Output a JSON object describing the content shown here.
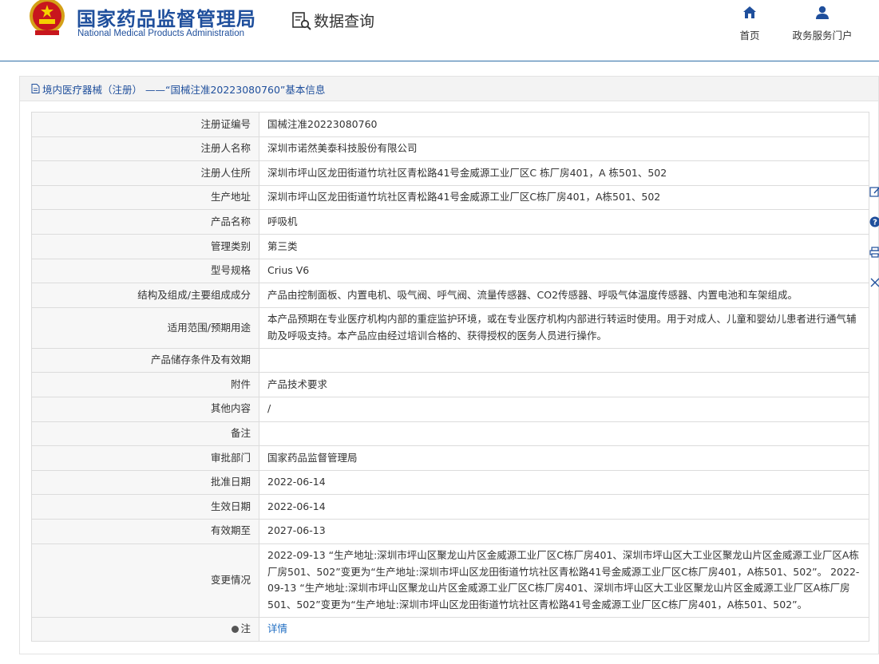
{
  "header": {
    "agency_name_cn": "国家药品监督管理局",
    "agency_name_en": "National Medical Products Administration",
    "data_query_label": "数据查询",
    "nav": {
      "home_label": "首页",
      "portal_label": "政务服务门户"
    },
    "brand_color": "#1f4f9c"
  },
  "panel": {
    "title": "境内医疗器械（注册） ——“国械注准20223080760”基本信息"
  },
  "fields": [
    {
      "label": "注册证编号",
      "value": "国械注准20223080760"
    },
    {
      "label": "注册人名称",
      "value": "深圳市诺然美泰科技股份有限公司"
    },
    {
      "label": "注册人住所",
      "value": "深圳市坪山区龙田街道竹坑社区青松路41号金威源工业厂区C 栋厂房401，A 栋501、502"
    },
    {
      "label": "生产地址",
      "value": "深圳市坪山区龙田街道竹坑社区青松路41号金威源工业厂区C栋厂房401，A栋501、502"
    },
    {
      "label": "产品名称",
      "value": "呼吸机"
    },
    {
      "label": "管理类别",
      "value": "第三类"
    },
    {
      "label": "型号规格",
      "value": "Crius V6"
    },
    {
      "label": "结构及组成/主要组成成分",
      "value": "产品由控制面板、内置电机、吸气阀、呼气阀、流量传感器、CO2传感器、呼吸气体温度传感器、内置电池和车架组成。"
    },
    {
      "label": "适用范围/预期用途",
      "value": "本产品预期在专业医疗机构内部的重症监护环境，或在专业医疗机构内部进行转运时使用。用于对成人、儿童和婴幼儿患者进行通气辅助及呼吸支持。本产品应由经过培训合格的、获得授权的医务人员进行操作。"
    },
    {
      "label": "产品储存条件及有效期",
      "value": ""
    },
    {
      "label": "附件",
      "value": "产品技术要求"
    },
    {
      "label": "其他内容",
      "value": "/"
    },
    {
      "label": "备注",
      "value": ""
    },
    {
      "label": "审批部门",
      "value": "国家药品监督管理局"
    },
    {
      "label": "批准日期",
      "value": "2022-06-14"
    },
    {
      "label": "生效日期",
      "value": "2022-06-14"
    },
    {
      "label": "有效期至",
      "value": "2027-06-13"
    },
    {
      "label": "变更情况",
      "value": "2022-09-13 “生产地址:深圳市坪山区聚龙山片区金威源工业厂区C栋厂房401、深圳市坪山区大工业区聚龙山片区金威源工业厂区A栋厂房501、502”变更为“生产地址:深圳市坪山区龙田街道竹坑社区青松路41号金威源工业厂区C栋厂房401，A栋501、502”。 2022-09-13 “生产地址:深圳市坪山区聚龙山片区金威源工业厂区C栋厂房401、深圳市坪山区大工业区聚龙山片区金威源工业厂区A栋厂房501、502”变更为“生产地址:深圳市坪山区龙田街道竹坑社区青松路41号金威源工业厂区C栋厂房401，A栋501、502”。"
    }
  ],
  "note": {
    "label": "注",
    "link_text": "详情"
  },
  "side_tools": [
    "edit-icon",
    "help-icon",
    "print-icon",
    "close-icon"
  ]
}
